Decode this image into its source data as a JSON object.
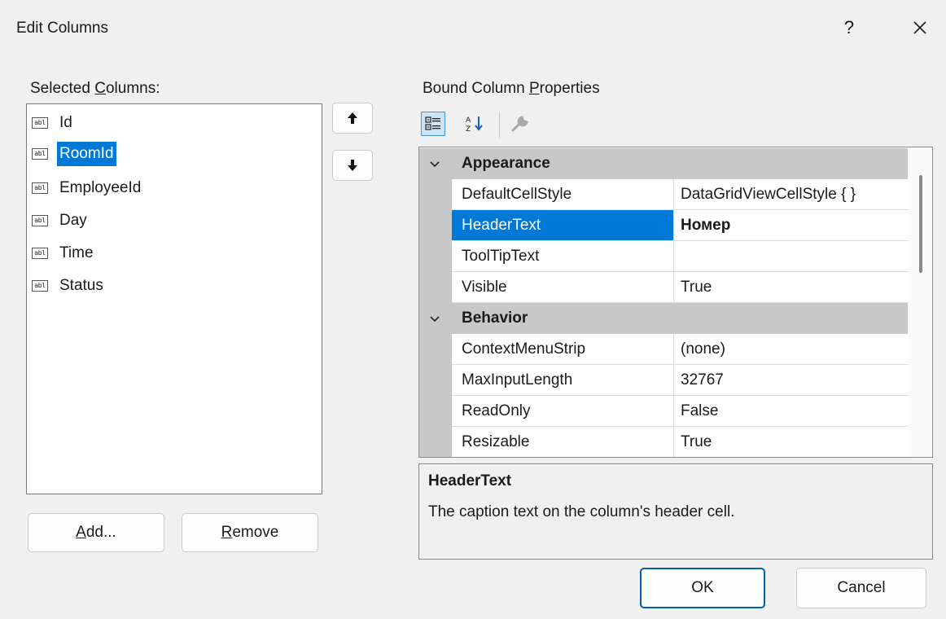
{
  "dialog": {
    "title": "Edit Columns",
    "help_label": "?",
    "close_label": "✕"
  },
  "selected_columns": {
    "label_before": "Selected ",
    "label_access": "C",
    "label_after": "olumns:",
    "items": [
      {
        "icon": "abl",
        "text": "Id"
      },
      {
        "icon": "abl",
        "text": "RoomId"
      },
      {
        "icon": "abl",
        "text": "EmployeeId"
      },
      {
        "icon": "abl",
        "text": "Day"
      },
      {
        "icon": "abl",
        "text": "Time"
      },
      {
        "icon": "abl",
        "text": "Status"
      }
    ],
    "selected_index": 1
  },
  "buttons": {
    "add_access": "A",
    "add_rest": "dd...",
    "remove_access": "R",
    "remove_rest": "emove",
    "ok": "OK",
    "cancel": "Cancel"
  },
  "properties": {
    "label_before": "Bound Column ",
    "label_access": "P",
    "label_after": "roperties",
    "toolbar_icons": [
      "categorized-icon",
      "alphabetical-icon",
      "property-pages-icon"
    ],
    "categories": [
      {
        "name": "Appearance",
        "rows": [
          {
            "name": "DefaultCellStyle",
            "value": "DataGridViewCellStyle { }"
          },
          {
            "name": "HeaderText",
            "value": "Номер"
          },
          {
            "name": "ToolTipText",
            "value": ""
          },
          {
            "name": "Visible",
            "value": "True"
          }
        ]
      },
      {
        "name": "Behavior",
        "rows": [
          {
            "name": "ContextMenuStrip",
            "value": "(none)"
          },
          {
            "name": "MaxInputLength",
            "value": "32767"
          },
          {
            "name": "ReadOnly",
            "value": "False"
          },
          {
            "name": "Resizable",
            "value": "True"
          }
        ]
      }
    ],
    "selected_property": "HeaderText"
  },
  "description": {
    "title": "HeaderText",
    "text": "The caption text on the column's header cell."
  },
  "colors": {
    "selection": "#0078d7",
    "category_bg": "#c8c8c8",
    "default_button_border": "#005fb8"
  }
}
